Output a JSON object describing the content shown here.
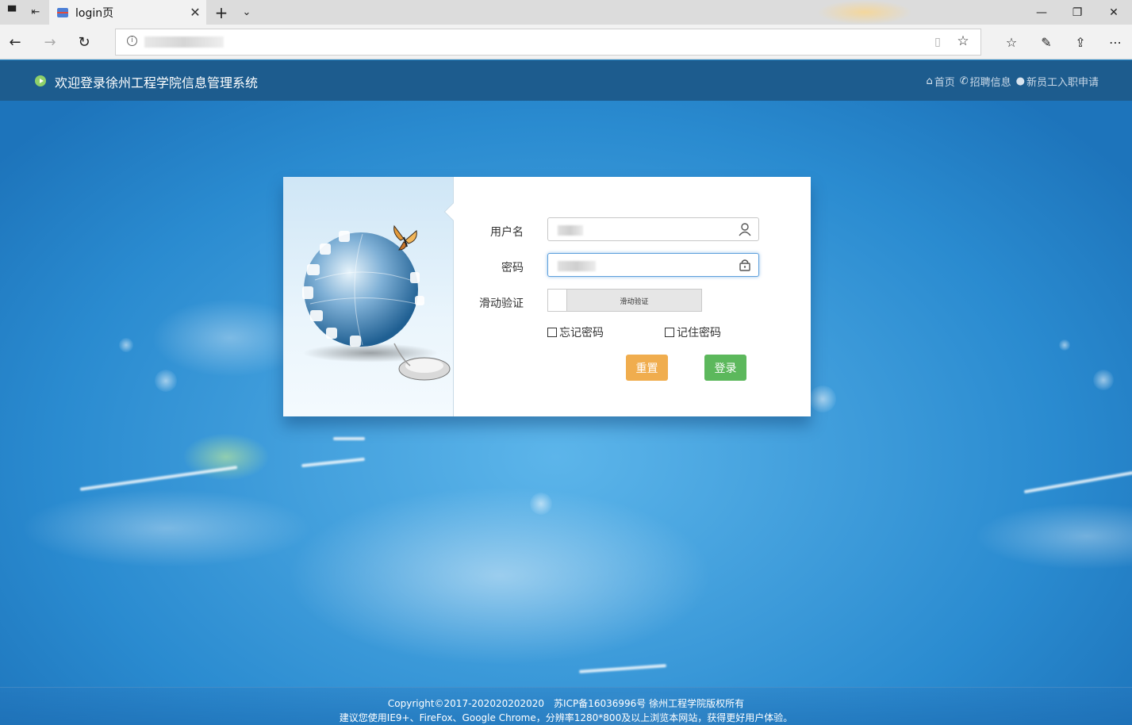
{
  "browser": {
    "tab_title": "login页",
    "new_tab_symbol": "+",
    "tab_menu_symbol": "⌄",
    "close_tab_symbol": "✕",
    "window_controls": {
      "minimize": "—",
      "restore": "❐",
      "close": "✕"
    },
    "nav": {
      "back": "←",
      "forward": "→",
      "refresh": "↻"
    },
    "icons": [
      "tab-preview-icon",
      "set-aside-tabs-icon",
      "reading-view-icon",
      "favorite-star-icon",
      "favorites-hub-icon",
      "web-note-icon",
      "share-icon",
      "more-icon"
    ]
  },
  "header": {
    "title": "欢迎登录徐州工程学院信息管理系统",
    "links": [
      {
        "label": "首页",
        "icon": "home-icon"
      },
      {
        "label": "招聘信息",
        "icon": "phone-icon"
      },
      {
        "label": "新员工入职申请",
        "icon": "user-icon"
      }
    ]
  },
  "login": {
    "username_label": "用户名",
    "password_label": "密码",
    "slider_label": "滑动验证",
    "slider_text": "滑动验证",
    "forgot_password": "忘记密码",
    "remember_password": "记住密码",
    "reset_button": "重置",
    "login_button": "登录"
  },
  "footer": {
    "line1": "Copyright©2017-202020202020　苏ICP备16036996号 徐州工程学院版权所有",
    "line2": "建议您使用IE9+、FireFox、Google Chrome，分辨率1280*800及以上浏览本网站，获得更好用户体验。"
  },
  "colors": {
    "header_bg": "#1d5c8e",
    "reset_button": "#f0ad4e",
    "login_button": "#5cb85c",
    "sky": "#2a8bd0"
  }
}
